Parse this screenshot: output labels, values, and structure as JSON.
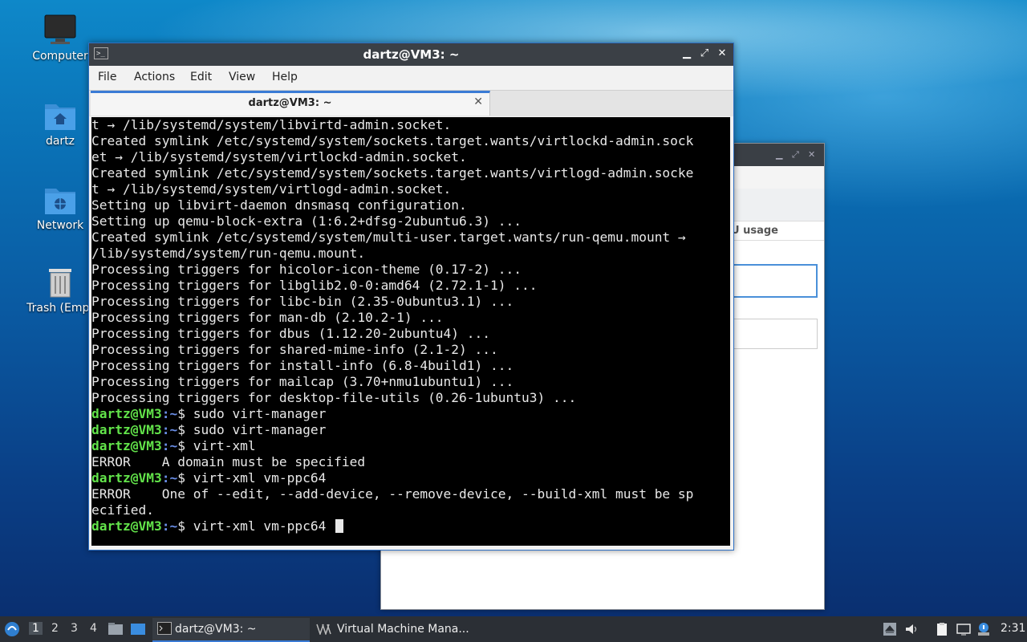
{
  "desktop": {
    "icons": [
      {
        "label": "Computer",
        "icon": "monitor-icon"
      },
      {
        "label": "dartz",
        "icon": "home-folder-icon"
      },
      {
        "label": "Network",
        "icon": "network-folder-icon"
      },
      {
        "label": "Trash (Empt",
        "icon": "trash-icon"
      }
    ]
  },
  "background_window": {
    "column_header": "U usage"
  },
  "terminal": {
    "title": "dartz@VM3: ~",
    "menu": [
      "File",
      "Actions",
      "Edit",
      "View",
      "Help"
    ],
    "tab_label": "dartz@VM3: ~",
    "user": "dartz@VM3",
    "path": ":~",
    "lines": [
      {
        "type": "out",
        "text": "t → /lib/systemd/system/libvirtd-admin.socket."
      },
      {
        "type": "out",
        "text": "Created symlink /etc/systemd/system/sockets.target.wants/virtlockd-admin.sock"
      },
      {
        "type": "out",
        "text": "et → /lib/systemd/system/virtlockd-admin.socket."
      },
      {
        "type": "out",
        "text": "Created symlink /etc/systemd/system/sockets.target.wants/virtlogd-admin.socke"
      },
      {
        "type": "out",
        "text": "t → /lib/systemd/system/virtlogd-admin.socket."
      },
      {
        "type": "out",
        "text": "Setting up libvirt-daemon dnsmasq configuration."
      },
      {
        "type": "out",
        "text": "Setting up qemu-block-extra (1:6.2+dfsg-2ubuntu6.3) ..."
      },
      {
        "type": "out",
        "text": "Created symlink /etc/systemd/system/multi-user.target.wants/run-qemu.mount →"
      },
      {
        "type": "out",
        "text": "/lib/systemd/system/run-qemu.mount."
      },
      {
        "type": "out",
        "text": "Processing triggers for hicolor-icon-theme (0.17-2) ..."
      },
      {
        "type": "out",
        "text": "Processing triggers for libglib2.0-0:amd64 (2.72.1-1) ..."
      },
      {
        "type": "out",
        "text": "Processing triggers for libc-bin (2.35-0ubuntu3.1) ..."
      },
      {
        "type": "out",
        "text": "Processing triggers for man-db (2.10.2-1) ..."
      },
      {
        "type": "out",
        "text": "Processing triggers for dbus (1.12.20-2ubuntu4) ..."
      },
      {
        "type": "out",
        "text": "Processing triggers for shared-mime-info (2.1-2) ..."
      },
      {
        "type": "out",
        "text": "Processing triggers for install-info (6.8-4build1) ..."
      },
      {
        "type": "out",
        "text": "Processing triggers for mailcap (3.70+nmu1ubuntu1) ..."
      },
      {
        "type": "out",
        "text": "Processing triggers for desktop-file-utils (0.26-1ubuntu3) ..."
      },
      {
        "type": "cmd",
        "text": "$ sudo virt-manager"
      },
      {
        "type": "cmd",
        "text": "$ sudo virt-manager"
      },
      {
        "type": "cmd",
        "text": "$ virt-xml"
      },
      {
        "type": "out",
        "text": "ERROR    A domain must be specified"
      },
      {
        "type": "cmd",
        "text": "$ virt-xml vm-ppc64"
      },
      {
        "type": "out",
        "text": "ERROR    One of --edit, --add-device, --remove-device, --build-xml must be sp"
      },
      {
        "type": "out",
        "text": "ecified."
      },
      {
        "type": "cmd",
        "text": "$ virt-xml vm-ppc64 ",
        "cursor": true
      }
    ]
  },
  "taskbar": {
    "workspaces": [
      "1",
      "2",
      "3",
      "4"
    ],
    "active_workspace": "1",
    "tasks": [
      {
        "label": "dartz@VM3: ~",
        "icon": "terminal-icon",
        "active": true
      },
      {
        "label": "Virtual Machine Mana...",
        "icon": "virt-manager-icon",
        "active": false
      }
    ],
    "clock": "2:31",
    "colors": {
      "bar": "#2b2f35",
      "active_underline": "#3a7bd5"
    }
  }
}
